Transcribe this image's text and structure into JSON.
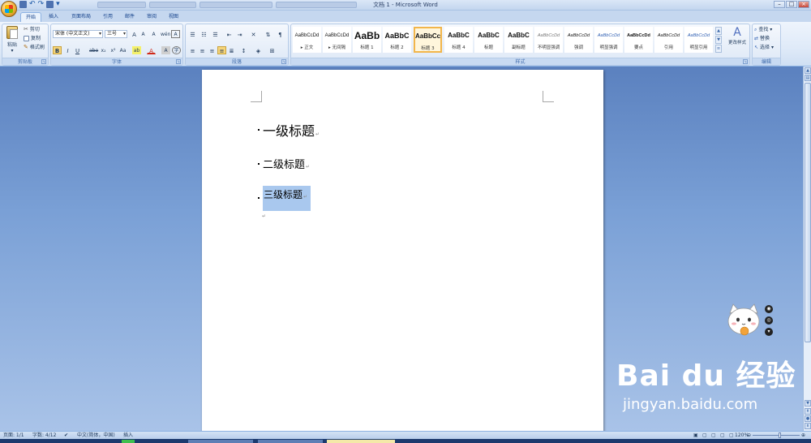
{
  "app": {
    "window_title": "文档 1 - Microsoft Word"
  },
  "tabs": [
    {
      "label": "开始"
    },
    {
      "label": "插入"
    },
    {
      "label": "页面布局"
    },
    {
      "label": "引用"
    },
    {
      "label": "邮件"
    },
    {
      "label": "审阅"
    },
    {
      "label": "视图"
    }
  ],
  "ribbon": {
    "clipboard": {
      "paste": "粘贴",
      "cut": "剪切",
      "copy": "复制",
      "format_painter": "格式刷",
      "group_label": "剪贴板"
    },
    "font": {
      "font_name": "宋体 (中文正文)",
      "font_size": "三号",
      "bold": "B",
      "italic": "I",
      "underline": "U",
      "strikethrough": "abe",
      "subscript": "x₂",
      "superscript": "x²",
      "change_case": "Aa",
      "grow": "A",
      "shrink": "A",
      "clear_format": "A",
      "phonetic": "wén",
      "border_char": "A",
      "highlight": "ab",
      "font_color": "A",
      "shading": "A",
      "enclosed": "字",
      "group_label": "字体"
    },
    "paragraph": {
      "group_label": "段落"
    },
    "styles": {
      "items": [
        {
          "sample": "AaBbCcDd",
          "name": "▸ 正文"
        },
        {
          "sample": "AaBbCcDd",
          "name": "▸ 无间隔"
        },
        {
          "sample": "AaBb",
          "name": "标题 1"
        },
        {
          "sample": "AaBbC",
          "name": "标题 2"
        },
        {
          "sample": "AaBbCc",
          "name": "标题 3"
        },
        {
          "sample": "AaBbC",
          "name": "标题 4"
        },
        {
          "sample": "AaBbC",
          "name": "标题"
        },
        {
          "sample": "AaBbC",
          "name": "副标题"
        },
        {
          "sample": "AaBbCcDd",
          "name": "不明显强调"
        },
        {
          "sample": "AaBbCcDd",
          "name": "强调"
        },
        {
          "sample": "AaBbCcDd",
          "name": "明显强调"
        },
        {
          "sample": "AaBbCcDd",
          "name": "要点"
        },
        {
          "sample": "AaBbCcDd",
          "name": "引用"
        },
        {
          "sample": "AaBbCcDd",
          "name": "明显引用"
        }
      ],
      "change_styles": "更改样式",
      "group_label": "样式"
    },
    "editing": {
      "find": "查找 ▾",
      "replace": "替换",
      "select": "选择 ▾",
      "group_label": "编辑"
    }
  },
  "document": {
    "heading1": "一级标题",
    "heading2": "二级标题",
    "heading3": "三级标题",
    "para_mark": "↵"
  },
  "overlay": {
    "watermark_main": "Bai du 经验",
    "watermark_sub": "jingyan.baidu.com"
  },
  "statusbar": {
    "page": "页面: 1/1",
    "words": "字数: 4/12",
    "language": "中文(简体，中国)",
    "mode": "插入",
    "zoom": "120%"
  }
}
